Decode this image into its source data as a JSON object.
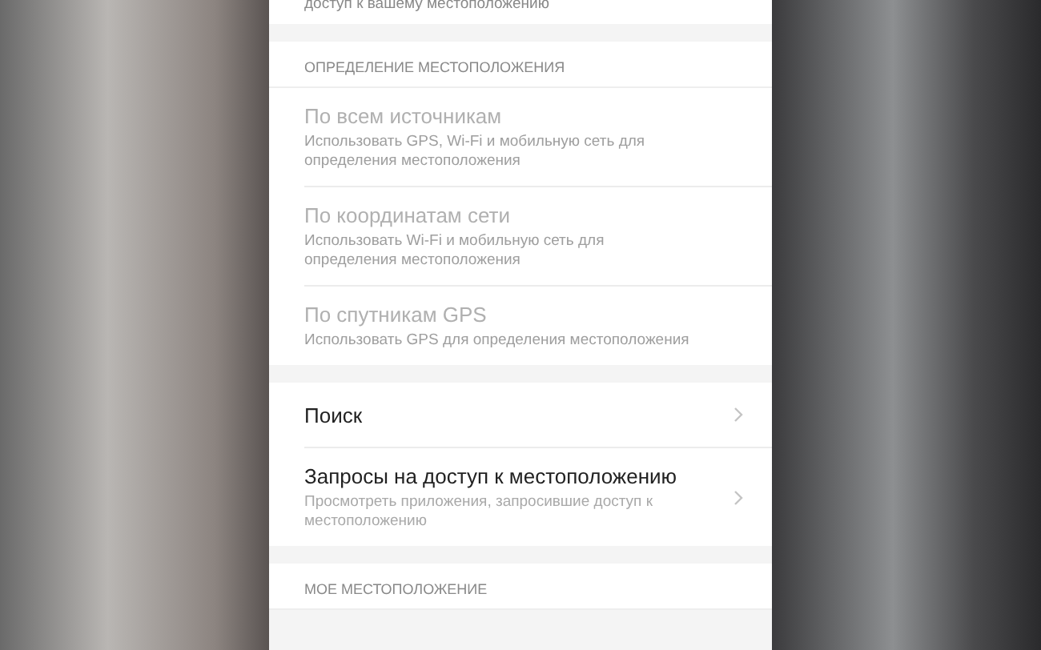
{
  "top_item": {
    "subtitle": "доступ к вашему местоположению"
  },
  "sections": [
    {
      "header": "ОПРЕДЕЛЕНИЕ МЕСТОПОЛОЖЕНИЯ",
      "items": [
        {
          "kind": "option",
          "title": "По всем источникам",
          "subtitle": "Использовать GPS, Wi-Fi и мобильную сеть для определения местоположения",
          "disabled": true
        },
        {
          "kind": "option",
          "title": "По координатам сети",
          "subtitle": "Использовать Wi-Fi и мобильную сеть для определения местоположения",
          "disabled": true
        },
        {
          "kind": "option",
          "title": "По спутникам GPS",
          "subtitle": "Использовать GPS для определения местоположения",
          "disabled": true
        }
      ]
    },
    {
      "items": [
        {
          "kind": "link",
          "title": "Поиск",
          "disabled": false
        },
        {
          "kind": "link",
          "title": "Запросы на доступ к местоположению",
          "subtitle": "Просмотреть приложения, запросившие доступ к местоположению",
          "disabled": false
        }
      ]
    },
    {
      "header": "МОЕ МЕСТОПОЛОЖЕНИЕ"
    }
  ]
}
